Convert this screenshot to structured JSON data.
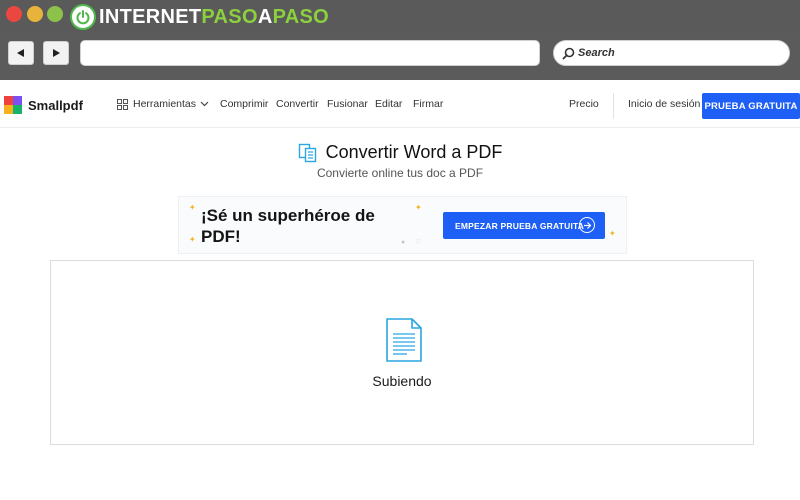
{
  "browser": {
    "brand": {
      "white_part": "INTERNET",
      "green_part_1": "PASO",
      "white_part_2": "A",
      "green_part_2": "PASO"
    },
    "back_label": "◀",
    "forward_label": "▶",
    "url": "",
    "search_placeholder": "Search"
  },
  "site": {
    "logo_name": "Smallpdf",
    "tools_label": "Herramientas",
    "nav": [
      "Comprimir",
      "Convertir",
      "Fusionar",
      "Editar",
      "Firmar"
    ],
    "pricing_label": "Precio",
    "login_label": "Inicio de sesión",
    "trial_label": "PRUEBA GRATUITA"
  },
  "main": {
    "title": "Convertir Word a PDF",
    "subtitle": "Convierte online tus doc a PDF",
    "promo": {
      "headline_line1": "¡Sé un superhéroe de",
      "headline_line2": "PDF!",
      "button_label": "EMPEZAR PRUEBA GRATUITA"
    },
    "upload_status": "Subiendo"
  },
  "colors": {
    "accent_blue": "#1e5ff5",
    "chrome_gray": "#5b5b5b",
    "brand_green": "#8ccf3f",
    "icon_blue": "#2aa6e0"
  }
}
